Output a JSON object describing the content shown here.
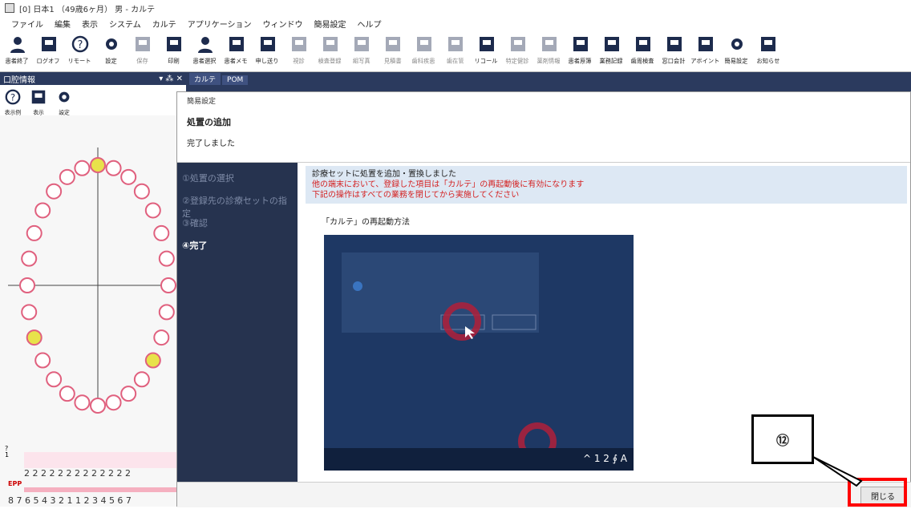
{
  "window": {
    "title": "[0] 日本1 （49歳6ヶ月） 男 - カルテ"
  },
  "menu": [
    "ファイル",
    "編集",
    "表示",
    "システム",
    "カルテ",
    "アプリケーション",
    "ウィンドウ",
    "簡易設定",
    "ヘルプ"
  ],
  "toolbar": [
    {
      "label": "患者終了",
      "icon": "person-close-icon",
      "enabled": true
    },
    {
      "label": "ログオフ",
      "icon": "logoff-icon",
      "enabled": true
    },
    {
      "label": "リモート",
      "icon": "help-circle-icon",
      "enabled": true
    },
    {
      "label": "設定",
      "icon": "gear-icon",
      "enabled": true
    },
    {
      "label": "保存",
      "icon": "save-icon",
      "enabled": false
    },
    {
      "label": "印刷",
      "icon": "printer-icon",
      "enabled": true
    },
    {
      "label": "患者選択",
      "icon": "person-search-icon",
      "enabled": true
    },
    {
      "label": "患者メモ",
      "icon": "book-icon",
      "enabled": true
    },
    {
      "label": "申し送り",
      "icon": "speech-bubble-icon",
      "enabled": true
    },
    {
      "label": "視診",
      "icon": "inspect-icon",
      "enabled": false
    },
    {
      "label": "検査登録",
      "icon": "exam-icon",
      "enabled": false
    },
    {
      "label": "組写真",
      "icon": "camera-icon",
      "enabled": false
    },
    {
      "label": "見積書",
      "icon": "estimate-icon",
      "enabled": false
    },
    {
      "label": "歯科疾患",
      "icon": "disease-icon",
      "enabled": false
    },
    {
      "label": "歯在管",
      "icon": "tooth-manage-icon",
      "enabled": false
    },
    {
      "label": "リコール",
      "icon": "recall-icon",
      "enabled": true
    },
    {
      "label": "特定健診",
      "icon": "checkup-icon",
      "enabled": false
    },
    {
      "label": "薬剤情報",
      "icon": "medicine-icon",
      "enabled": false
    },
    {
      "label": "患者原簿",
      "icon": "ledger-icon",
      "enabled": true
    },
    {
      "label": "業務記録",
      "icon": "clipboard-icon",
      "enabled": true
    },
    {
      "label": "歯周検査",
      "icon": "periodontal-icon",
      "enabled": true
    },
    {
      "label": "窓口会計",
      "icon": "yen-icon",
      "enabled": true
    },
    {
      "label": "アポイント",
      "icon": "calendar-icon",
      "enabled": true
    },
    {
      "label": "簡易設定",
      "icon": "quick-settings-icon",
      "enabled": true
    },
    {
      "label": "お知らせ",
      "icon": "notification-icon",
      "enabled": true
    }
  ],
  "left_panel": {
    "title": "口腔情報",
    "controls": "▾ ⁂ ✕",
    "tools": [
      {
        "label": "表示例",
        "icon": "info-icon"
      },
      {
        "label": "表示",
        "icon": "filter-icon"
      },
      {
        "label": "設定",
        "icon": "gear-icon"
      }
    ],
    "epp_label": "EPP",
    "upper_row": "2 2 2 2 2 2 2   2 2 2 2   2 2",
    "lower_row": "8 7 6 5 4 3 2 1 1 2 3 4 5 6 7",
    "tooth_labels_upper": [
      "8",
      "7",
      "6",
      "5",
      "4",
      "3",
      "2",
      "1",
      "1",
      "2",
      "3",
      "4"
    ],
    "side_marks": [
      "?",
      "1"
    ]
  },
  "tabs": [
    "カルテ",
    "POM"
  ],
  "dialog": {
    "window_title": "簡易設定",
    "heading": "処置の追加",
    "status": "完了しました",
    "steps": [
      "①処置の選択",
      "②登録先の診療セットの指定",
      "③確認",
      "④完了"
    ],
    "active_step": 3,
    "message_line1": "診療セットに処置を追加・置換しました",
    "message_line2": "他の端末において、登録した項目は「カルテ」の再起動後に有効になります",
    "message_line3": "下記の操作はすべての業務を閉じてから実施してください",
    "howto_title": "「カルテ」の再起動方法",
    "screenshot_taskbar": "^ 1 2 ∮ A",
    "close_label": "閉じる"
  },
  "callout": {
    "label": "⑫"
  },
  "colors": {
    "accent_red": "#ff0000",
    "panel_navy": "#2b3a5e",
    "step_active": "#ffffff"
  }
}
